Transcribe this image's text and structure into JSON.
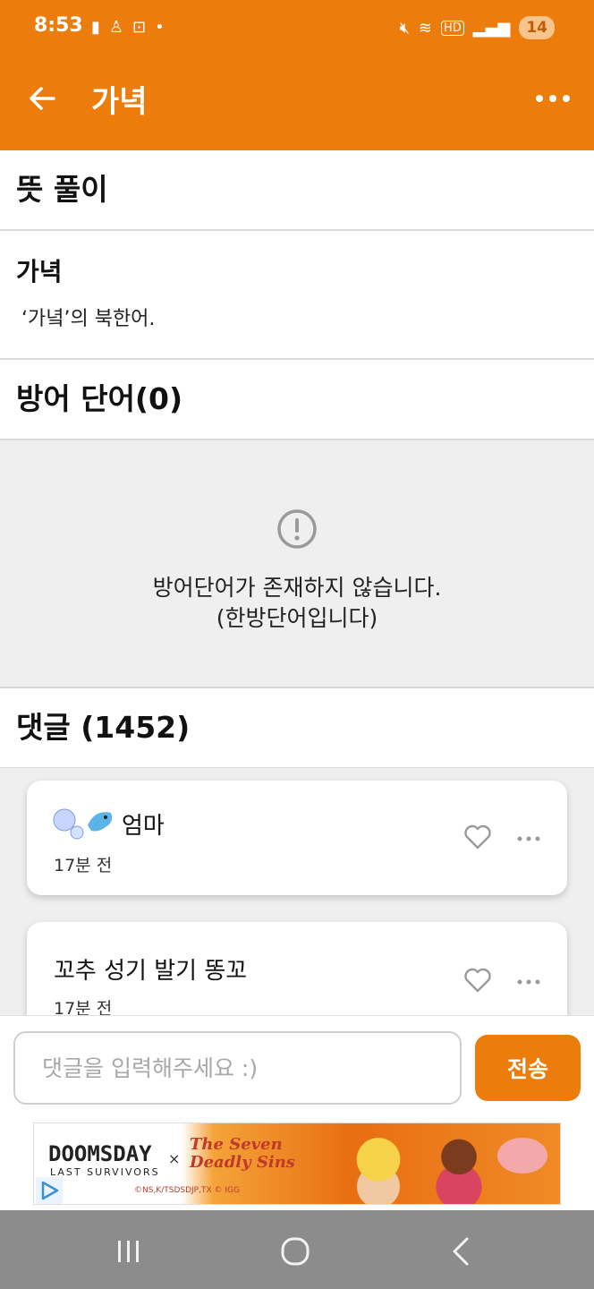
{
  "status_bar": {
    "time": "8:53",
    "battery": "14",
    "network": "HD"
  },
  "app_bar": {
    "title": "가녁"
  },
  "meaning": {
    "header": "뜻 풀이",
    "word": "가녁",
    "definition": "‘가녘’의 북한어."
  },
  "defense": {
    "header": "방어 단어(0)",
    "empty_line1": "방어단어가 존재하지 않습니다.",
    "empty_line2": "(한방단어입니다)"
  },
  "comments": {
    "header": "댓글 (1452)",
    "items": [
      {
        "author": "엄마",
        "time": "17분 전"
      },
      {
        "author": "꼬추 성기 발기 똥꼬",
        "time": "17분 전"
      }
    ]
  },
  "input": {
    "placeholder": "댓글을 입력해주세요 :)",
    "send_label": "전송"
  },
  "ad": {
    "brand1": "DOOMSDAY",
    "brand1_sub": "LAST SURVIVORS",
    "brand2_line1": "The Seven",
    "brand2_line2": "Deadly Sins",
    "copyright": "©NS,K/TSDSDJP,TX © IGG"
  },
  "colors": {
    "accent": "#EC7C0C",
    "section_bg": "#efefef"
  }
}
